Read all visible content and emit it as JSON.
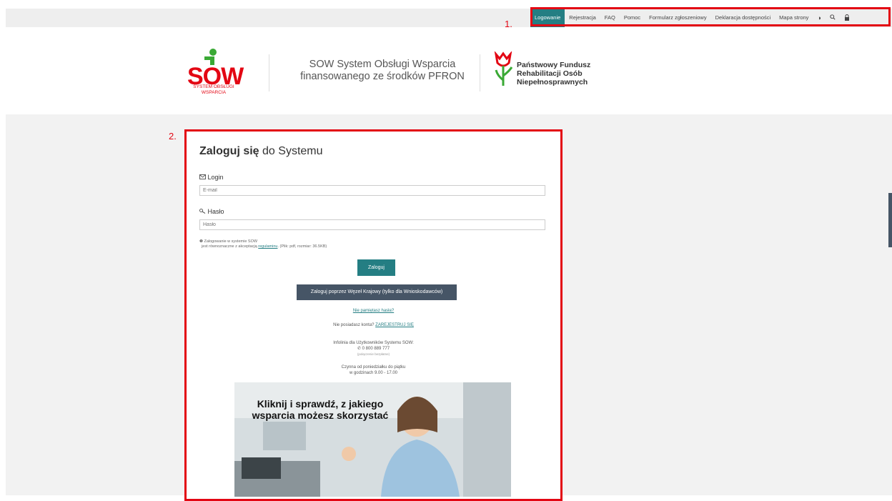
{
  "nav": {
    "items": [
      "Logowanie",
      "Rejestracja",
      "FAQ",
      "Pomoc",
      "Formularz zgłoszeniowy",
      "Deklaracja dostępności",
      "Mapa strony"
    ],
    "active": "Logowanie",
    "icons": [
      "contrast-icon",
      "zoom-icon",
      "lock-icon"
    ]
  },
  "annotations": {
    "one": "1.",
    "two": "2."
  },
  "header": {
    "sow_logo": "SOW",
    "sow_sub_1": "SYSTEM OBSŁUGI",
    "sow_sub_2": "WSPARCIA",
    "tagline_1": "SOW System Obsługi Wsparcia",
    "tagline_2": "finansowanego ze środków PFRON",
    "pfron_1": "Państwowy Fundusz",
    "pfron_2": "Rehabilitacji Osób",
    "pfron_3": "Niepełnosprawnych"
  },
  "login": {
    "title_bold": "Zaloguj się",
    "title_rest": " do Systemu",
    "login_label": "Login",
    "login_placeholder": "E-mail",
    "password_label": "Hasło",
    "password_placeholder": "Hasło",
    "note_1": "Zalogowanie w systemie SOW",
    "note_2": "jest równoznaczne z akceptacją",
    "note_link": "regulaminu",
    "note_3": ". (Plik: pdf, rozmiar: 36.5KB)",
    "login_button": "Zaloguj",
    "wk_button": "Zaloguj poprzez Węzeł Krajowy (tylko dla Wnioskodawców)",
    "forgot": "Nie pamiętasz hasła?",
    "no_account": "Nie posiadasz konta?",
    "register": "ZAREJESTRUJ SIĘ",
    "infoline": "Infolinia dla Użytkowników Systemu SOW:",
    "phone": "0 800 889 777",
    "phone_note": "(połączenie bezpłatne)",
    "hours_1": "Czynna od poniedziałku do piątku",
    "hours_2": "w godzinach 9.00 - 17.00"
  },
  "banner": {
    "text": "Kliknij i sprawdź, z jakiego wsparcia możesz skorzystać"
  },
  "colors": {
    "teal": "#247e83",
    "dark": "#465566",
    "red": "#e30613"
  }
}
